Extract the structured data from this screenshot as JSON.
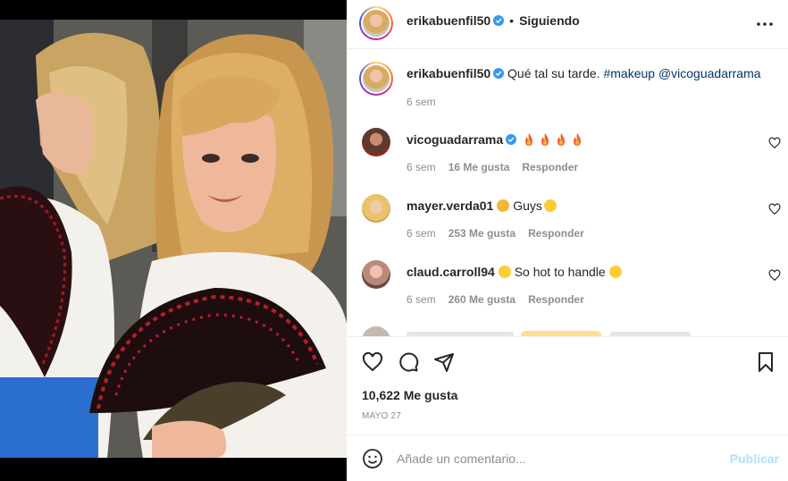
{
  "post": {
    "author": "erikabuenfil50",
    "separator": "•",
    "follow_status": "Siguiendo",
    "caption_text": "Qué tal su tarde. ",
    "caption_hashtag": "#makeup",
    "caption_mention": "@vicoguadarrama",
    "caption_time": "6 sem",
    "likes": "10,622 Me gusta",
    "date": "MAYO 27"
  },
  "comments": [
    {
      "user": "vicoguadarrama",
      "verified": true,
      "emojis": [
        "fire-emoji",
        "fire-emoji",
        "fire-emoji",
        "fire-emoji"
      ],
      "text": "",
      "time": "6 sem",
      "likes": "16 Me gusta",
      "reply": "Responder",
      "avatar_color": "#5a3b2e"
    },
    {
      "user": "mayer.verda01",
      "verified": false,
      "text": "Guys",
      "time": "6 sem",
      "likes": "253 Me gusta",
      "reply": "Responder",
      "avatar_color": "#e8c36b"
    },
    {
      "user": "claud.carroll94",
      "verified": false,
      "text": "So hot to handle",
      "time": "6 sem",
      "likes": "260 Me gusta",
      "reply": "Responder",
      "avatar_color": "#b98a7a"
    }
  ],
  "composer": {
    "placeholder": "Añade un comentario...",
    "publish": "Publicar"
  },
  "colors": {
    "verified": "#3897f0",
    "link": "#00376b",
    "muted": "#8e8e8e",
    "publish_disabled": "#b2dffc"
  }
}
